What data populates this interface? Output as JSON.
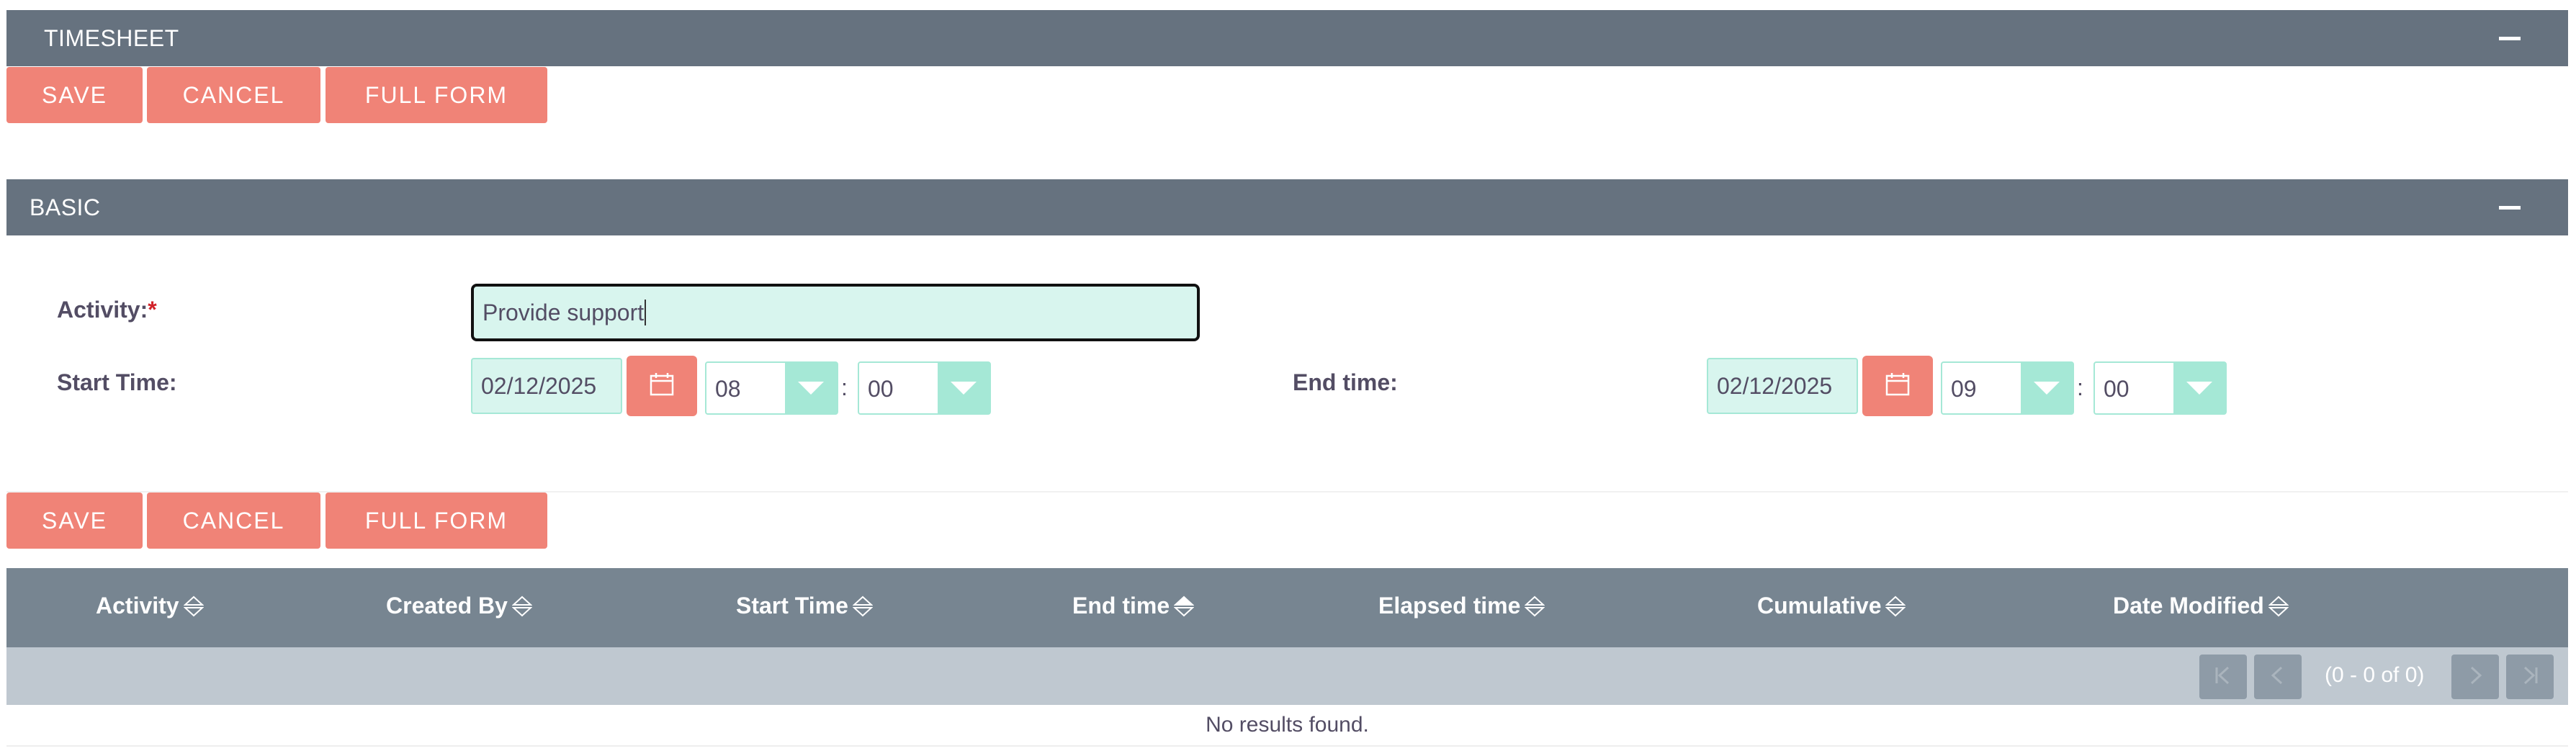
{
  "timesheet_panel": {
    "title": "TIMESHEET"
  },
  "top_actions": {
    "save": "SAVE",
    "cancel": "CANCEL",
    "full_form": "FULL FORM"
  },
  "basic_panel": {
    "title": "BASIC"
  },
  "form": {
    "activity_label": "Activity:",
    "required_mark": "*",
    "activity_value": "Provide support",
    "start_label": "Start Time:",
    "start_date": "02/12/2025",
    "start_hour": "08",
    "start_minute": "00",
    "end_label": "End time:",
    "end_date": "02/12/2025",
    "end_hour": "09",
    "end_minute": "00",
    "time_separator": ":"
  },
  "bottom_actions": {
    "save": "SAVE",
    "cancel": "CANCEL",
    "full_form": "FULL FORM"
  },
  "table": {
    "columns": [
      "Activity",
      "Created By",
      "Start Time",
      "End time",
      "Elapsed time",
      "Cumulative",
      "Date Modified"
    ],
    "sorted_column": "End time",
    "pagination": "(0 - 0 of 0)",
    "empty_message": "No results found."
  },
  "icons": {
    "calendar": "calendar-icon",
    "dropdown": "chevron-down-icon",
    "sort": "sort-icon",
    "collapse": "minus-icon"
  },
  "colors": {
    "header_bg": "#66727f",
    "button_bg": "#f08377",
    "input_bg": "#d8f5ee",
    "select_accent": "#a5e8d6",
    "table_head_bg": "#778591",
    "pager_bg": "#bfc8d0"
  }
}
